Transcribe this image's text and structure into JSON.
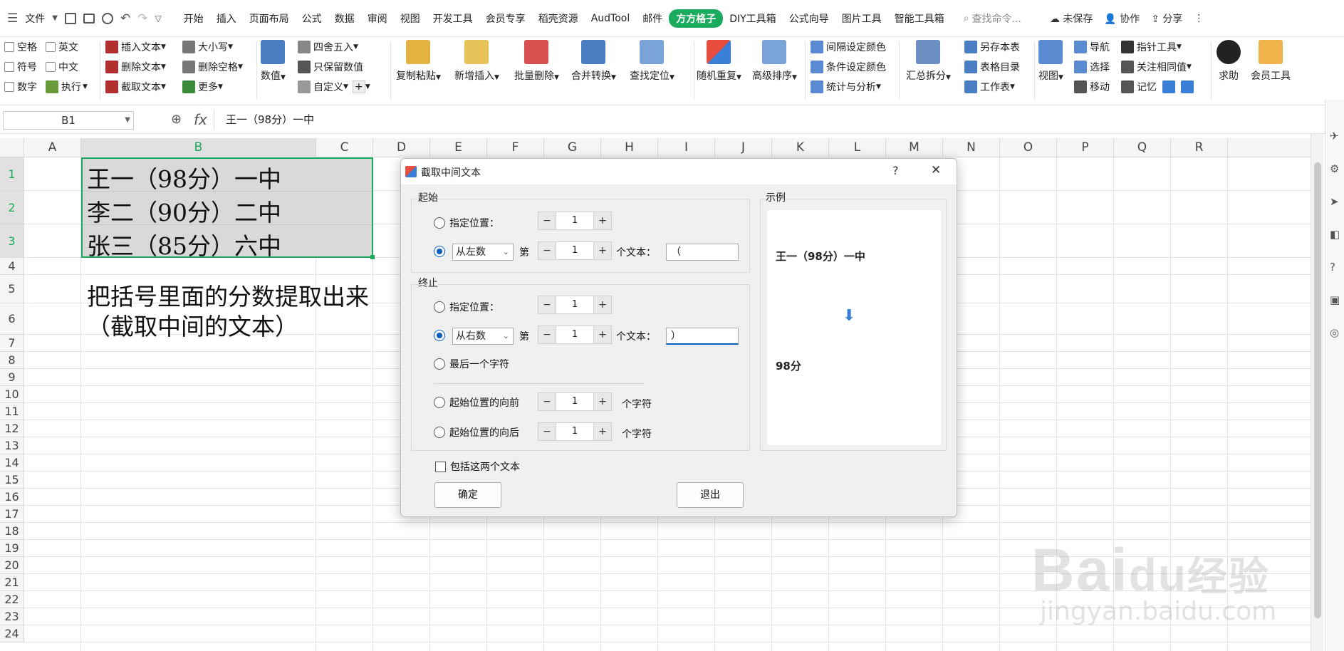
{
  "menubar": {
    "file": "文件",
    "tabs": [
      "开始",
      "插入",
      "页面布局",
      "公式",
      "数据",
      "审阅",
      "视图",
      "开发工具",
      "会员专享",
      "稻壳资源",
      "AudTool",
      "邮件",
      "方方格子",
      "DIY工具箱",
      "公式向导",
      "图片工具",
      "智能工具箱"
    ],
    "active_tab": "方方格子",
    "search_placeholder": "查找命令...",
    "unsaved": "未保存",
    "collab": "协作",
    "share": "分享"
  },
  "ribbon": {
    "checks": [
      "空格",
      "英文",
      "符号",
      "中文",
      "数字"
    ],
    "exec": "执行",
    "text_ops": [
      "插入文本",
      "删除文本",
      "截取文本"
    ],
    "case_ops": [
      "大小写",
      "删除空格",
      "更多"
    ],
    "numeric": "数值",
    "round_ops": [
      "四舍五入",
      "只保留数值",
      "自定义"
    ],
    "big_buttons": [
      "复制粘贴",
      "新增插入",
      "批量删除",
      "合并转换",
      "查找定位",
      "随机重复",
      "高级排序"
    ],
    "color_ops": [
      "间隔设定颜色",
      "条件设定颜色",
      "统计与分析"
    ],
    "summary": "汇总拆分",
    "save_ops": [
      "另存本表",
      "表格目录",
      "工作表"
    ],
    "view": "视图",
    "nav_ops": [
      "导航",
      "选择",
      "移动"
    ],
    "pointer_ops": [
      "指针工具",
      "关注相同值",
      "记忆"
    ],
    "help": "求助",
    "member": "会员工具"
  },
  "formula_bar": {
    "name_box": "B1",
    "fx": "fx",
    "content": "王一（98分）一中"
  },
  "columns": [
    "A",
    "B",
    "C",
    "D",
    "E",
    "F",
    "G",
    "H",
    "I",
    "J",
    "K",
    "L",
    "M",
    "N",
    "O",
    "P",
    "Q",
    "R"
  ],
  "rows": [
    "1",
    "2",
    "3",
    "4",
    "5",
    "6",
    "7",
    "8",
    "9",
    "10",
    "11",
    "12",
    "13",
    "14",
    "15",
    "16",
    "17",
    "18",
    "19",
    "20",
    "21",
    "22",
    "23",
    "24"
  ],
  "cells": {
    "b1": "王一（98分）一中",
    "b2": "李二（90分）二中",
    "b3": "张三（85分）六中",
    "b5": "把括号里面的分数提取出来",
    "b6": "（截取中间的文本）"
  },
  "dialog": {
    "title": "截取中间文本",
    "help": "?",
    "close": "✕",
    "start_group": "起始",
    "start_pos_label": "指定位置：",
    "start_pos_value": "1",
    "start_from": "从左数",
    "start_nth_label": "第",
    "start_nth_value": "1",
    "start_text_label": "个文本：",
    "start_text_value": "（",
    "end_group": "终止",
    "end_pos_label": "指定位置：",
    "end_pos_value": "1",
    "end_from": "从右数",
    "end_nth_label": "第",
    "end_nth_value": "1",
    "end_text_label": "个文本：",
    "end_text_value": "）",
    "last_char": "最后一个字符",
    "before_start": "起始位置的向前",
    "before_value": "1",
    "before_unit": "个字符",
    "after_start": "起始位置的向后",
    "after_value": "1",
    "after_unit": "个字符",
    "include_both": "包括这两个文本",
    "ok": "确定",
    "exit": "退出",
    "example_group": "示例",
    "example_input": "王一（98分）一中",
    "example_output": "98分"
  },
  "watermark": {
    "main": "Bai",
    "mid": "du",
    "tail": "经验",
    "sub": "jingyan.baidu.com"
  }
}
